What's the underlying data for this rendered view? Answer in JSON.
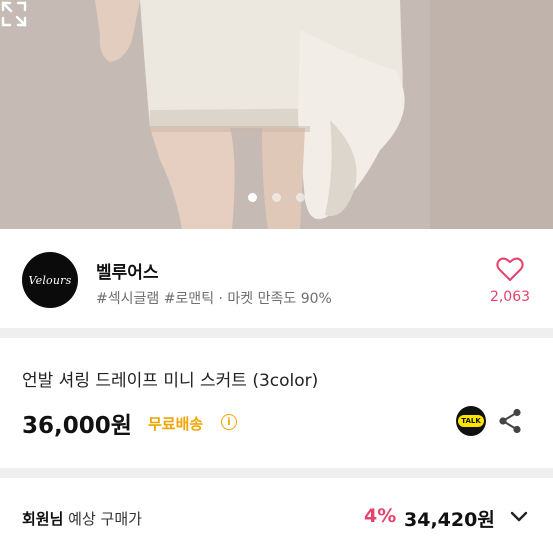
{
  "gallery": {
    "image": "product-photo-skirt",
    "dot_count": 3,
    "active_index": 0,
    "expand_icon": "expand-icon"
  },
  "store": {
    "logo_text": "Velours",
    "name": "벨루어스",
    "tags": "#섹시글램 #로맨틱 · 마켓 만족도 90%",
    "like_count": "2,063",
    "heart_icon": "heart-outline-icon"
  },
  "product": {
    "title": "언발 셔링 드레이프 미니 스커트 (3color)",
    "price": "36,000원",
    "shipping": "무료배송",
    "info_icon_glyph": "i",
    "talk_badge": "TALK",
    "share_icon": "share-icon"
  },
  "member_price": {
    "label_bold": "회원님",
    "label_rest": " 예상 구매가",
    "discount": "4%",
    "price": "34,420원",
    "chevron_icon": "chevron-down-icon"
  },
  "colors": {
    "accent_pink": "#e5436b",
    "shipping_yellow": "#f0a500",
    "kakao_yellow": "#fde500"
  }
}
